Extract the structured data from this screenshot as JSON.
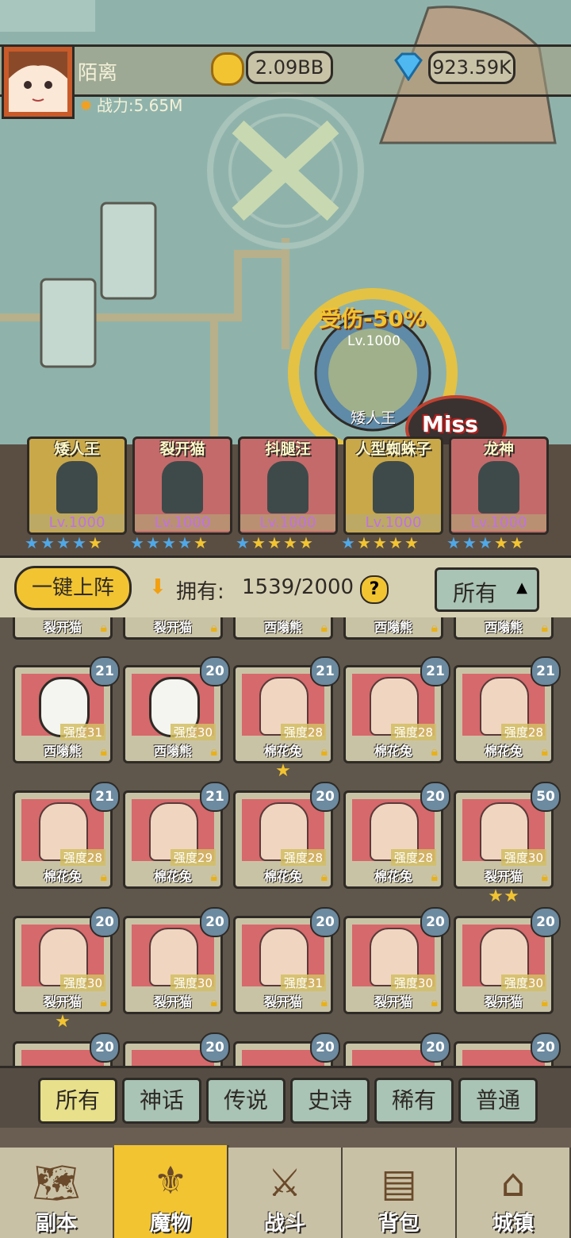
{
  "player": {
    "name": "陌离",
    "power": "战力:5.65M",
    "gold": "2.09BB",
    "gems": "923.59K"
  },
  "battle": {
    "damage_text": "受伤-50%",
    "boss_level": "Lv.1000",
    "boss_name": "矮人王",
    "miss_text": "Miss"
  },
  "team": [
    {
      "name": "矮人王",
      "level": "Lv.1000",
      "stars": [
        1,
        1,
        1,
        1,
        0
      ]
    },
    {
      "name": "裂开猫",
      "level": "Lv.1000",
      "stars": [
        1,
        1,
        1,
        1,
        0
      ]
    },
    {
      "name": "抖腿汪",
      "level": "Lv.1000",
      "stars": [
        1,
        0,
        0,
        0,
        0
      ]
    },
    {
      "name": "人型蜘蛛子",
      "level": "Lv.1000",
      "stars": [
        1,
        0,
        0,
        0,
        0
      ]
    },
    {
      "name": "龙神",
      "level": "Lv.1000",
      "stars": [
        1,
        1,
        1,
        0,
        0
      ]
    }
  ],
  "toolbar": {
    "deploy_label": "一键上阵",
    "owned_label": "拥有:",
    "owned_count": "1539/2000",
    "help": "?",
    "filter_label": "所有"
  },
  "partial_row": [
    "裂开猫",
    "裂开猫",
    "西嗡熊",
    "西嗡熊",
    "西嗡熊"
  ],
  "monsters": [
    {
      "name": "西嗡熊",
      "level": "21",
      "power": "强度31",
      "stars": 0
    },
    {
      "name": "西嗡熊",
      "level": "20",
      "power": "强度30",
      "stars": 0
    },
    {
      "name": "棉花兔",
      "level": "21",
      "power": "强度28",
      "stars": 1
    },
    {
      "name": "棉花兔",
      "level": "21",
      "power": "强度28",
      "stars": 0
    },
    {
      "name": "棉花兔",
      "level": "21",
      "power": "强度28",
      "stars": 0
    },
    {
      "name": "棉花兔",
      "level": "21",
      "power": "强度28",
      "stars": 0
    },
    {
      "name": "棉花兔",
      "level": "21",
      "power": "强度29",
      "stars": 0
    },
    {
      "name": "棉花兔",
      "level": "20",
      "power": "强度28",
      "stars": 0
    },
    {
      "name": "棉花兔",
      "level": "20",
      "power": "强度28",
      "stars": 0
    },
    {
      "name": "裂开猫",
      "level": "50",
      "power": "强度30",
      "stars": 2
    },
    {
      "name": "裂开猫",
      "level": "20",
      "power": "强度30",
      "stars": 1
    },
    {
      "name": "裂开猫",
      "level": "20",
      "power": "强度30",
      "stars": 0
    },
    {
      "name": "裂开猫",
      "level": "20",
      "power": "强度31",
      "stars": 0
    },
    {
      "name": "裂开猫",
      "level": "20",
      "power": "强度30",
      "stars": 0
    },
    {
      "name": "裂开猫",
      "level": "20",
      "power": "强度30",
      "stars": 0
    }
  ],
  "bottom_row_levels": [
    "20",
    "20",
    "20",
    "20",
    "20"
  ],
  "filters": [
    "所有",
    "神话",
    "传说",
    "史诗",
    "稀有",
    "普通"
  ],
  "nav": [
    "副本",
    "魔物",
    "战斗",
    "背包",
    "城镇"
  ],
  "colors": {
    "accent": "#f2c431",
    "card_red": "#d6696b",
    "filter_active": "#e8e08a",
    "filter_default": "#a9c3b4"
  }
}
